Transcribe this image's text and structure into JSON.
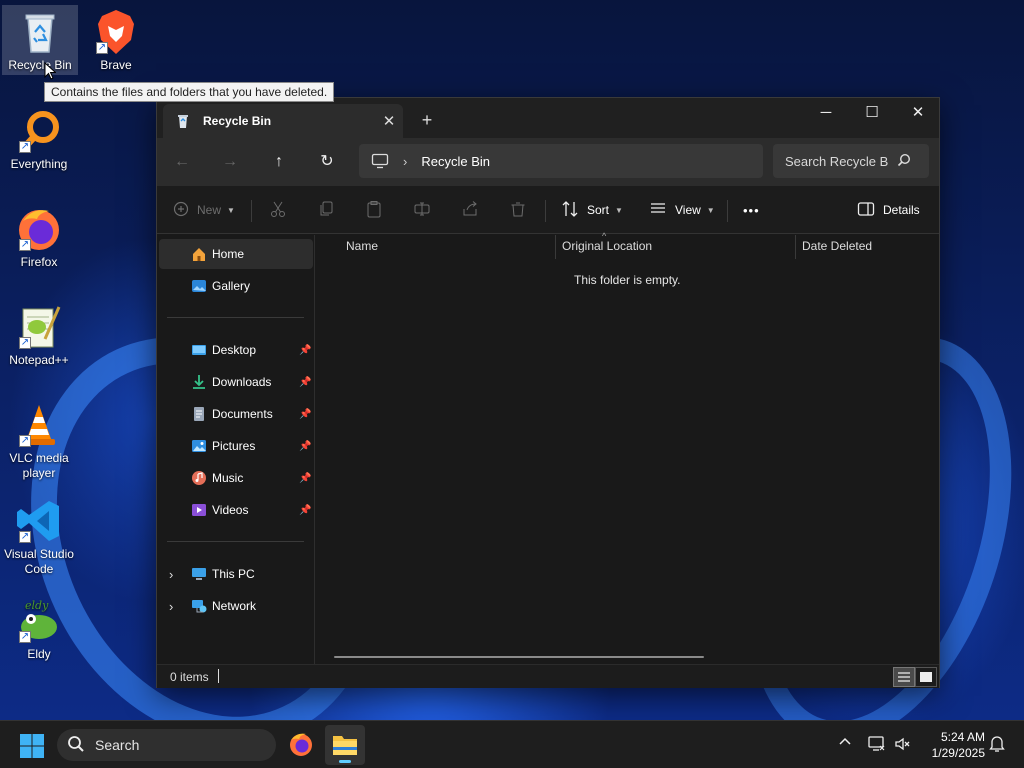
{
  "desktop": {
    "icons": [
      {
        "label": "Recycle Bin"
      },
      {
        "label": "Brave"
      },
      {
        "label": "Everything"
      },
      {
        "label": "Firefox"
      },
      {
        "label": "Notepad++"
      },
      {
        "label": "VLC media player"
      },
      {
        "label": "Visual Studio Code"
      },
      {
        "label": "Eldy"
      }
    ],
    "tooltip": "Contains the files and folders that you have deleted."
  },
  "window": {
    "tab_title": "Recycle Bin",
    "address_crumb": "Recycle Bin",
    "search_placeholder": "Search Recycle Bin",
    "toolbar": {
      "new_label": "New",
      "sort_label": "Sort",
      "view_label": "View",
      "more_label": "•••",
      "details_label": "Details"
    },
    "sidebar": {
      "items": [
        {
          "label": "Home",
          "active": true
        },
        {
          "label": "Gallery"
        },
        {
          "label": "Desktop",
          "pinned": true
        },
        {
          "label": "Downloads",
          "pinned": true
        },
        {
          "label": "Documents",
          "pinned": true
        },
        {
          "label": "Pictures",
          "pinned": true
        },
        {
          "label": "Music",
          "pinned": true
        },
        {
          "label": "Videos",
          "pinned": true
        },
        {
          "label": "This PC"
        },
        {
          "label": "Network"
        }
      ]
    },
    "columns": [
      "Name",
      "Original Location",
      "Date Deleted"
    ],
    "empty_message": "This folder is empty.",
    "status": {
      "item_count": "0 items"
    }
  },
  "taskbar": {
    "search_label": "Search",
    "time": "5:24 AM",
    "date": "1/29/2025"
  },
  "colors": {
    "accent": "#60cdff",
    "window_bg": "#191919",
    "taskbar_bg": "#1e1e1e"
  }
}
